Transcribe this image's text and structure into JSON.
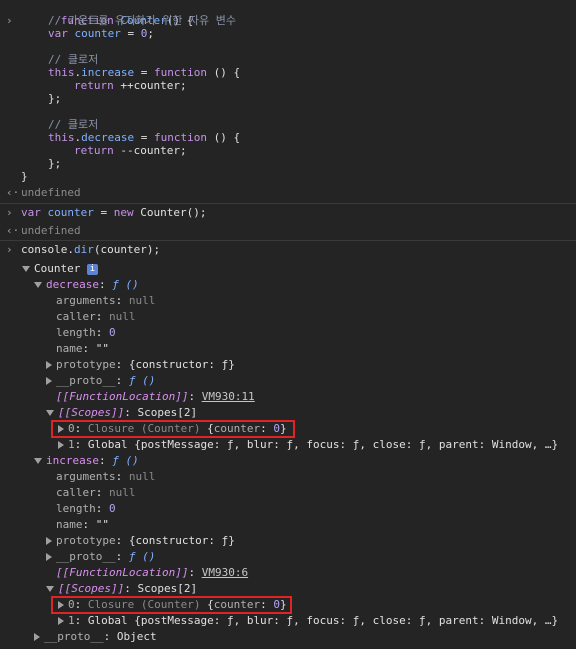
{
  "code_entry": {
    "lines": [
      [
        "function",
        " ",
        "Counter",
        "() {"
      ],
      [
        "// 카운트를 유지하기 위한 자유 변수"
      ],
      [
        "var",
        " ",
        "counter",
        " = ",
        "0",
        ";"
      ],
      [
        ""
      ],
      [
        "// 클로저"
      ],
      [
        "this",
        ".",
        "increase",
        " = ",
        "function",
        " () {"
      ],
      [
        "return",
        " ++",
        "counter",
        ";"
      ],
      [
        "};"
      ],
      [
        ""
      ],
      [
        "// 클로저"
      ],
      [
        "this",
        ".",
        "decrease",
        " = ",
        "function",
        " () {"
      ],
      [
        "return",
        " --",
        "counter",
        ";"
      ],
      [
        "};"
      ],
      [
        "}"
      ]
    ],
    "result": "undefined"
  },
  "entry2": {
    "kw_var": "var",
    "name": "counter",
    "eq": " = ",
    "kw_new": "new",
    "call": "Counter();",
    "result": "undefined"
  },
  "entry3": {
    "obj": "console",
    "dot": ".",
    "method": "dir",
    "args": "(counter);"
  },
  "tree": {
    "root": "Counter",
    "info": "i",
    "decrease": {
      "key": "decrease",
      "sig": "ƒ ()",
      "arguments_key": "arguments",
      "arguments_val": "null",
      "caller_key": "caller",
      "caller_val": "null",
      "length_key": "length",
      "length_val": "0",
      "name_key": "name",
      "name_val": "\"\"",
      "prototype_key": "prototype",
      "prototype_val": "{constructor: ƒ}",
      "proto_key": "__proto__",
      "proto_val": "ƒ ()",
      "floc_key": "[[FunctionLocation]]",
      "floc_val": "VM930:11",
      "scopes_key": "[[Scopes]]",
      "scopes_val": "Scopes[2]",
      "scope0_key": "0",
      "scope0_type": "Closure (Counter)",
      "scope0_open": "{",
      "scope0_inner_key": "counter",
      "scope0_inner_val": "0",
      "scope0_close": "}",
      "scope1_key": "1",
      "scope1_val": "Global {postMessage: ƒ, blur: ƒ, focus: ƒ, close: ƒ, parent: Window, …}"
    },
    "increase": {
      "key": "increase",
      "sig": "ƒ ()",
      "arguments_key": "arguments",
      "arguments_val": "null",
      "caller_key": "caller",
      "caller_val": "null",
      "length_key": "length",
      "length_val": "0",
      "name_key": "name",
      "name_val": "\"\"",
      "prototype_key": "prototype",
      "prototype_val": "{constructor: ƒ}",
      "proto_key": "__proto__",
      "proto_val": "ƒ ()",
      "floc_key": "[[FunctionLocation]]",
      "floc_val": "VM930:6",
      "scopes_key": "[[Scopes]]",
      "scopes_val": "Scopes[2]",
      "scope0_key": "0",
      "scope0_type": "Closure (Counter)",
      "scope0_open": "{",
      "scope0_inner_key": "counter",
      "scope0_inner_val": "0",
      "scope0_close": "}",
      "scope1_key": "1",
      "scope1_val": "Global {postMessage: ƒ, blur: ƒ, focus: ƒ, close: ƒ, parent: Window, …}"
    },
    "proto": {
      "key": "__proto__",
      "val": "Object"
    }
  },
  "colors": {
    "background": "#242424",
    "highlight_box": "#e02424",
    "keyword": "#c792ea",
    "identifier": "#7fb0ff"
  }
}
